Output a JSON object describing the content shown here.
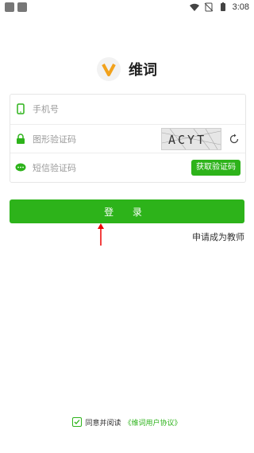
{
  "status_bar": {
    "time": "3:08"
  },
  "header": {
    "app_name": "维词"
  },
  "form": {
    "phone_placeholder": "手机号",
    "captcha_placeholder": "图形验证码",
    "captcha_image_text": "ACYT",
    "sms_placeholder": "短信验证码",
    "sms_button_label": "获取验证码"
  },
  "actions": {
    "login_label": "登 录",
    "apply_teacher_label": "申请成为教师"
  },
  "agreement": {
    "text": "同意并阅读",
    "link": "《维词用户协议》"
  },
  "colors": {
    "accent": "#2db31a",
    "logo_orange": "#f2a21c"
  }
}
